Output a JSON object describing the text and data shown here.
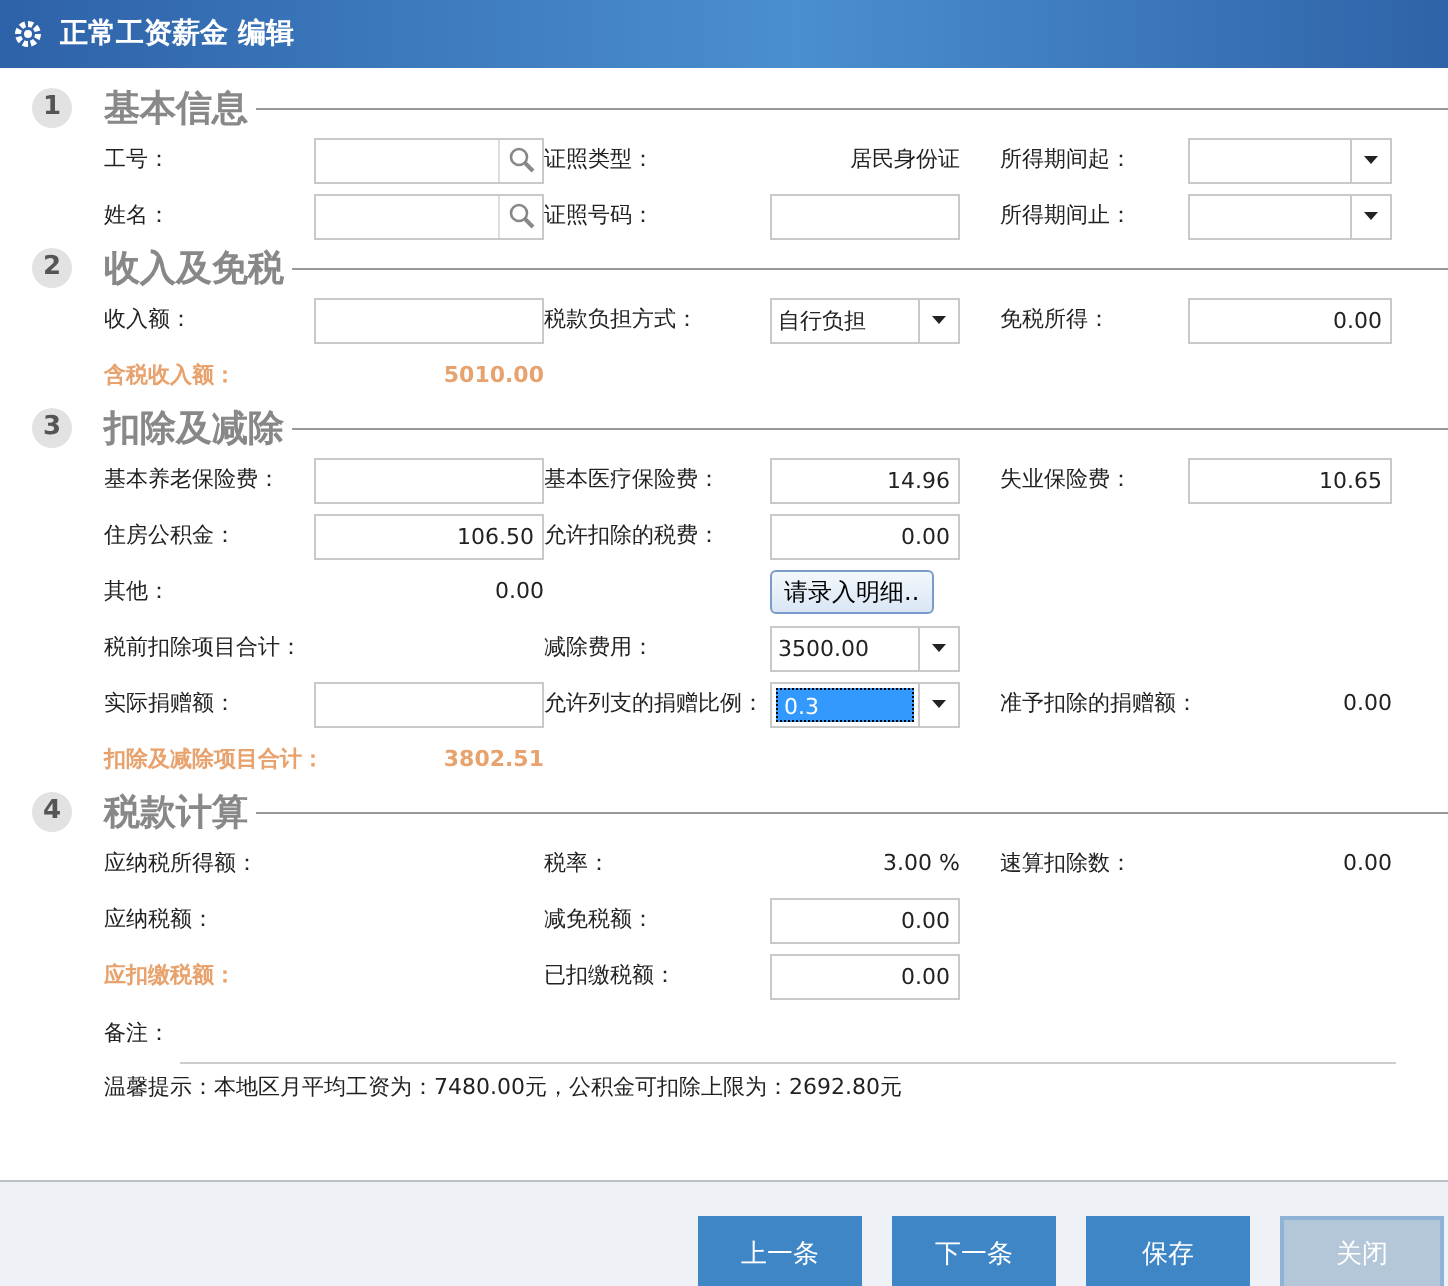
{
  "window": {
    "title": "正常工资薪金 编辑"
  },
  "sections": [
    {
      "number": "1",
      "title": "基本信息",
      "rows": [
        [
          {
            "kind": "search",
            "label": "工号："
          },
          {
            "kind": "static",
            "label": "证照类型：",
            "value": "居民身份证"
          },
          {
            "kind": "date",
            "label": "所得期间起："
          }
        ],
        [
          {
            "kind": "search",
            "label": "姓名："
          },
          {
            "kind": "field",
            "label": "证照号码："
          },
          {
            "kind": "date",
            "label": "所得期间止："
          }
        ]
      ]
    },
    {
      "number": "2",
      "title": "收入及免税",
      "rows": [
        [
          {
            "kind": "field",
            "label": "收入额："
          },
          {
            "kind": "combo",
            "label": "税款负担方式：",
            "value": "自行负担",
            "text_selected": false
          },
          {
            "kind": "field",
            "label": "免税所得：",
            "value": "0.00"
          }
        ],
        [
          {
            "kind": "total",
            "label": "含税收入额：",
            "value": "5010.00"
          }
        ]
      ]
    },
    {
      "number": "3",
      "title": "扣除及减除",
      "rows": [
        [
          {
            "kind": "field",
            "label": "基本养老保险费："
          },
          {
            "kind": "field",
            "label": "基本医疗保险费：",
            "value": "14.96"
          },
          {
            "kind": "field",
            "label": "失业保险费：",
            "value": "10.65"
          }
        ],
        [
          {
            "kind": "field",
            "label": "住房公积金：",
            "value": "106.50"
          },
          {
            "kind": "field",
            "label": "允许扣除的税费：",
            "value": "0.00"
          }
        ],
        [
          {
            "kind": "static",
            "label": "其他：",
            "value": "0.00"
          },
          {
            "kind": "button",
            "value": "请录入明细.."
          }
        ],
        [
          {
            "kind": "static",
            "label": "税前扣除项目合计："
          },
          {
            "kind": "combo",
            "label": "减除费用：",
            "value": "3500.00",
            "text_selected": false
          }
        ],
        [
          {
            "kind": "field",
            "label": "实际捐赠额："
          },
          {
            "kind": "combo",
            "label": "允许列支的捐赠比例：",
            "value": "0.3",
            "text_selected": true
          },
          {
            "kind": "static",
            "label": "准予扣除的捐赠额：",
            "value": "0.00"
          }
        ],
        [
          {
            "kind": "total",
            "label": "扣除及减除项目合计：",
            "value": "3802.51"
          }
        ]
      ]
    },
    {
      "number": "4",
      "title": "税款计算",
      "rows": [
        [
          {
            "kind": "static",
            "label": "应纳税所得额："
          },
          {
            "kind": "static",
            "label": "税率：",
            "value": "3.00 %"
          },
          {
            "kind": "static",
            "label": "速算扣除数：",
            "value": "0.00"
          }
        ],
        [
          {
            "kind": "static",
            "label": "应纳税额："
          },
          {
            "kind": "field",
            "label": "减免税额：",
            "value": "0.00"
          }
        ],
        [
          {
            "kind": "total",
            "label": "应扣缴税额："
          },
          {
            "kind": "field",
            "label": "已扣缴税额：",
            "value": "0.00"
          }
        ]
      ]
    }
  ],
  "remark": {
    "label": "备注："
  },
  "tip": "温馨提示：本地区月平均工资为：7480.00元，公积金可扣除上限为：2692.80元",
  "buttons": [
    {
      "label": "上一条",
      "kind": "primary"
    },
    {
      "label": "下一条",
      "kind": "primary"
    },
    {
      "label": "保存",
      "kind": "primary"
    },
    {
      "label": "关闭",
      "kind": "light"
    }
  ]
}
